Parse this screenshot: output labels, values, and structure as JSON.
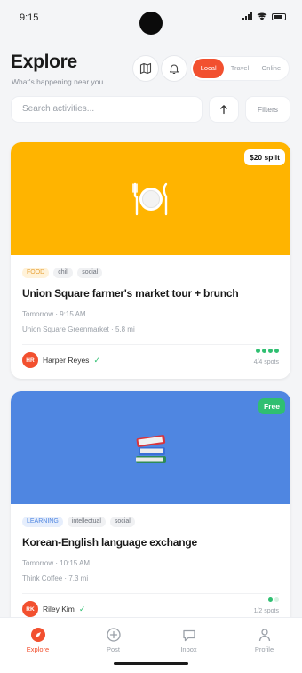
{
  "status": {
    "time": "9:15"
  },
  "header": {
    "title": "Explore",
    "subtitle": "What's happening near you",
    "segments": [
      "Local",
      "Travel",
      "Online"
    ],
    "active_segment": 0
  },
  "search": {
    "placeholder": "Search activities...",
    "filters_label": "Filters"
  },
  "cards": [
    {
      "banner_color": "#FFB400",
      "banner_icon": "plate-icon",
      "badge": "$20 split",
      "badge_bg": "#ffffff",
      "badge_color": "#1a1a1a",
      "tags": [
        {
          "label": "FOOD",
          "bg": "#FFF2D9",
          "color": "#E8A33A"
        },
        {
          "label": "chill",
          "bg": "#F0F1F3",
          "color": "#6B7079"
        },
        {
          "label": "social",
          "bg": "#F0F1F3",
          "color": "#6B7079"
        }
      ],
      "title": "Union Square farmer's market tour + brunch",
      "when": "Tomorrow · 9:15 AM",
      "where": "Union Square Greenmarket · 5.8 mi",
      "host_initials": "HR",
      "host_name": "Harper Reyes",
      "spots_filled": 4,
      "spots_total": 4,
      "spots_label": "4/4 spots"
    },
    {
      "banner_color": "#4F86E1",
      "banner_icon": "books-icon",
      "badge": "Free",
      "badge_bg": "#2FBF71",
      "badge_color": "#ffffff",
      "tags": [
        {
          "label": "LEARNING",
          "bg": "#E6EEFC",
          "color": "#4F86E1"
        },
        {
          "label": "intellectual",
          "bg": "#F0F1F3",
          "color": "#6B7079"
        },
        {
          "label": "social",
          "bg": "#F0F1F3",
          "color": "#6B7079"
        }
      ],
      "title": "Korean-English language exchange",
      "when": "Tomorrow · 10:15 AM",
      "where": "Think Coffee · 7.3 mi",
      "host_initials": "RK",
      "host_name": "Riley Kim",
      "spots_filled": 1,
      "spots_total": 2,
      "spots_label": "1/2 spots"
    }
  ],
  "tabbar": [
    {
      "label": "Explore",
      "icon": "compass-icon",
      "active": true
    },
    {
      "label": "Post",
      "icon": "plus-circle-icon",
      "active": false
    },
    {
      "label": "Inbox",
      "icon": "chat-bubble-icon",
      "active": false
    },
    {
      "label": "Profile",
      "icon": "person-icon",
      "active": false
    }
  ],
  "colors": {
    "accent": "#F2502F",
    "success": "#2FBF71"
  }
}
